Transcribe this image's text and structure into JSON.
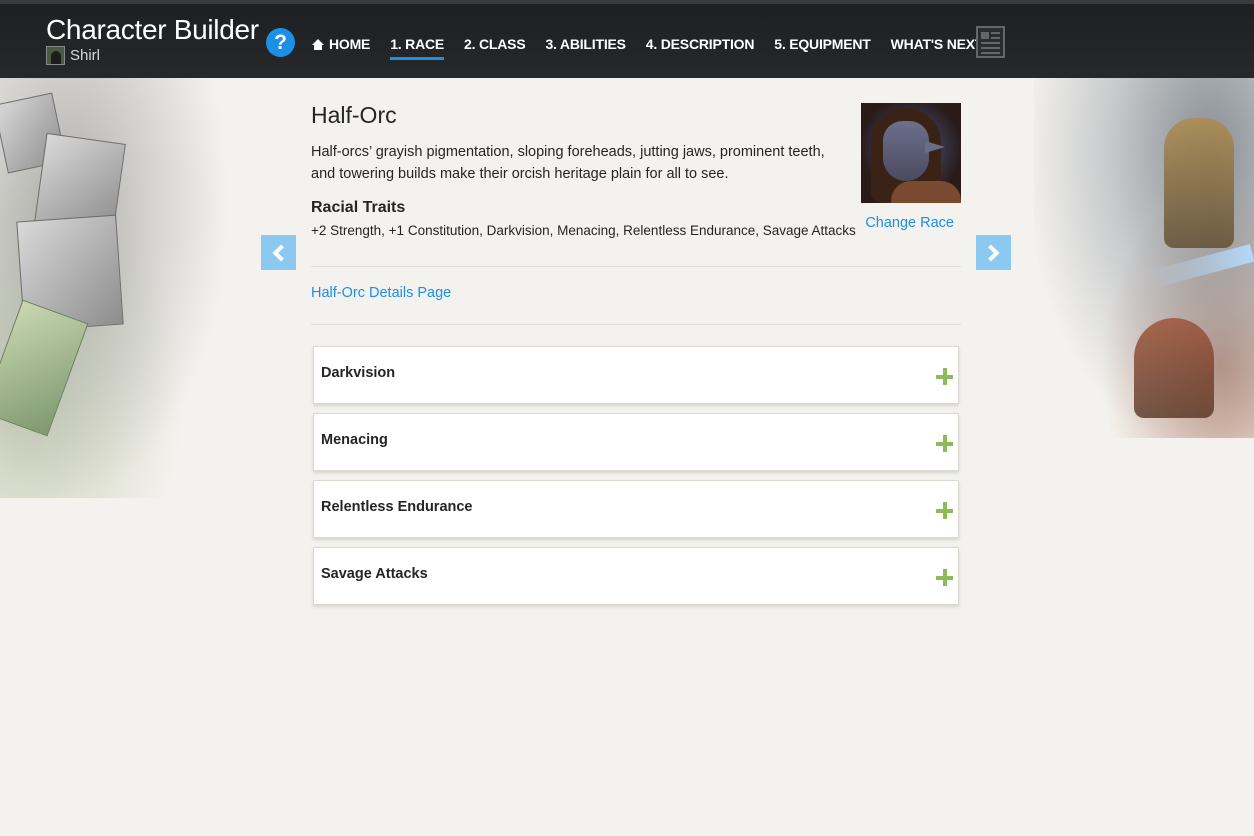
{
  "header": {
    "app_title": "Character Builder",
    "character_name": "Shirl",
    "help_label": "?",
    "nav": [
      {
        "label": "HOME",
        "icon": "home-icon"
      },
      {
        "label": "1. RACE",
        "active": true
      },
      {
        "label": "2. CLASS"
      },
      {
        "label": "3. ABILITIES"
      },
      {
        "label": "4. DESCRIPTION"
      },
      {
        "label": "5. EQUIPMENT"
      },
      {
        "label": "WHAT'S NEXT",
        "icon": "caret-right-icon"
      }
    ],
    "accent_color": "#1c8fe6"
  },
  "race": {
    "name": "Half-Orc",
    "description": "Half-orcs’ grayish pigmentation, sloping foreheads, jutting jaws, prominent teeth, and towering builds make their orcish heritage plain for all to see.",
    "traits_title": "Racial Traits",
    "traits_list": "+2 Strength, +1 Constitution, Darkvision, Menacing, Relentless Endurance, Savage Attacks",
    "change_race_label": "Change Race",
    "details_link": "Half-Orc Details Page"
  },
  "features": [
    {
      "name": "Darkvision"
    },
    {
      "name": "Menacing"
    },
    {
      "name": "Relentless Endurance"
    },
    {
      "name": "Savage Attacks"
    }
  ],
  "colors": {
    "plus": "#8cbb5a",
    "arrow": "#8cc9f0"
  }
}
